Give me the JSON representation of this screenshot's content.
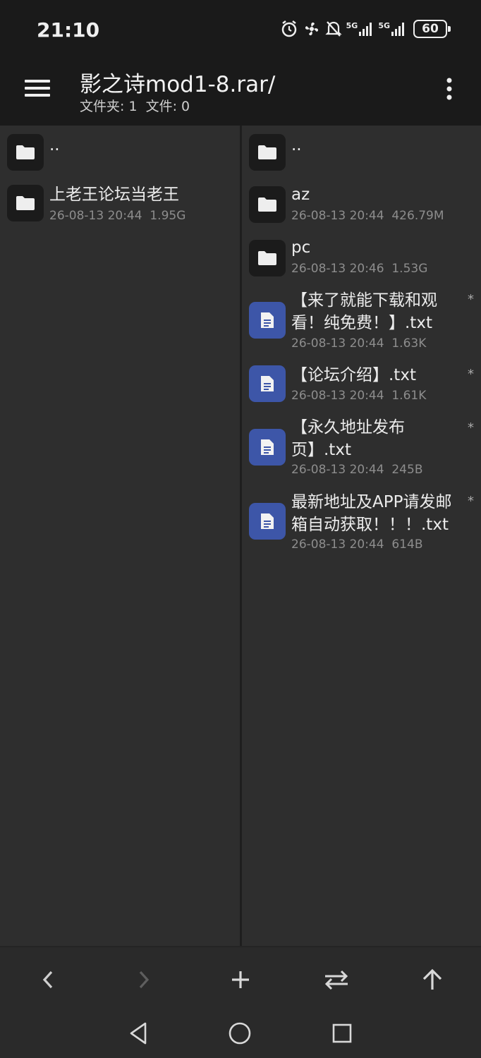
{
  "status": {
    "time": "21:10",
    "battery": "60",
    "signal1": "5G",
    "signal2": "5G"
  },
  "header": {
    "title": "影之诗mod1-8.rar/",
    "subtitle": "文件夹: 1  文件: 0"
  },
  "left_pane": {
    "items": [
      {
        "name": "..",
        "meta": "",
        "type": "folder"
      },
      {
        "name": "上老王论坛当老王",
        "meta": "26-08-13 20:44  1.95G",
        "type": "folder"
      }
    ]
  },
  "right_pane": {
    "items": [
      {
        "name": "..",
        "meta": "",
        "type": "folder"
      },
      {
        "name": "az",
        "meta": "26-08-13 20:44  426.79M",
        "type": "folder"
      },
      {
        "name": "pc",
        "meta": "26-08-13 20:46  1.53G",
        "type": "folder"
      },
      {
        "name": "【来了就能下载和观看！纯免费！】.txt",
        "meta": "26-08-13 20:44  1.63K",
        "type": "txt",
        "star": "*"
      },
      {
        "name": "【论坛介绍】.txt",
        "meta": "26-08-13 20:44  1.61K",
        "type": "txt",
        "star": "*"
      },
      {
        "name": "【永久地址发布页】.txt",
        "meta": "26-08-13 20:44  245B",
        "type": "txt",
        "star": "*"
      },
      {
        "name": "最新地址及APP请发邮箱自动获取！！！.txt",
        "meta": "26-08-13 20:44  614B",
        "type": "txt",
        "star": "*"
      }
    ]
  },
  "icons": {
    "menu": "hamburger-menu-icon",
    "more": "more-vertical-icon",
    "folder": "folder-icon",
    "file": "text-file-icon",
    "back": "chevron-left-icon",
    "forward": "chevron-right-icon",
    "add": "plus-icon",
    "swap": "swap-arrows-icon",
    "up": "arrow-up-icon"
  },
  "colors": {
    "accent_doc": "#3d56a8",
    "background": "#2e2e2e",
    "bar": "#1a1a1a"
  }
}
